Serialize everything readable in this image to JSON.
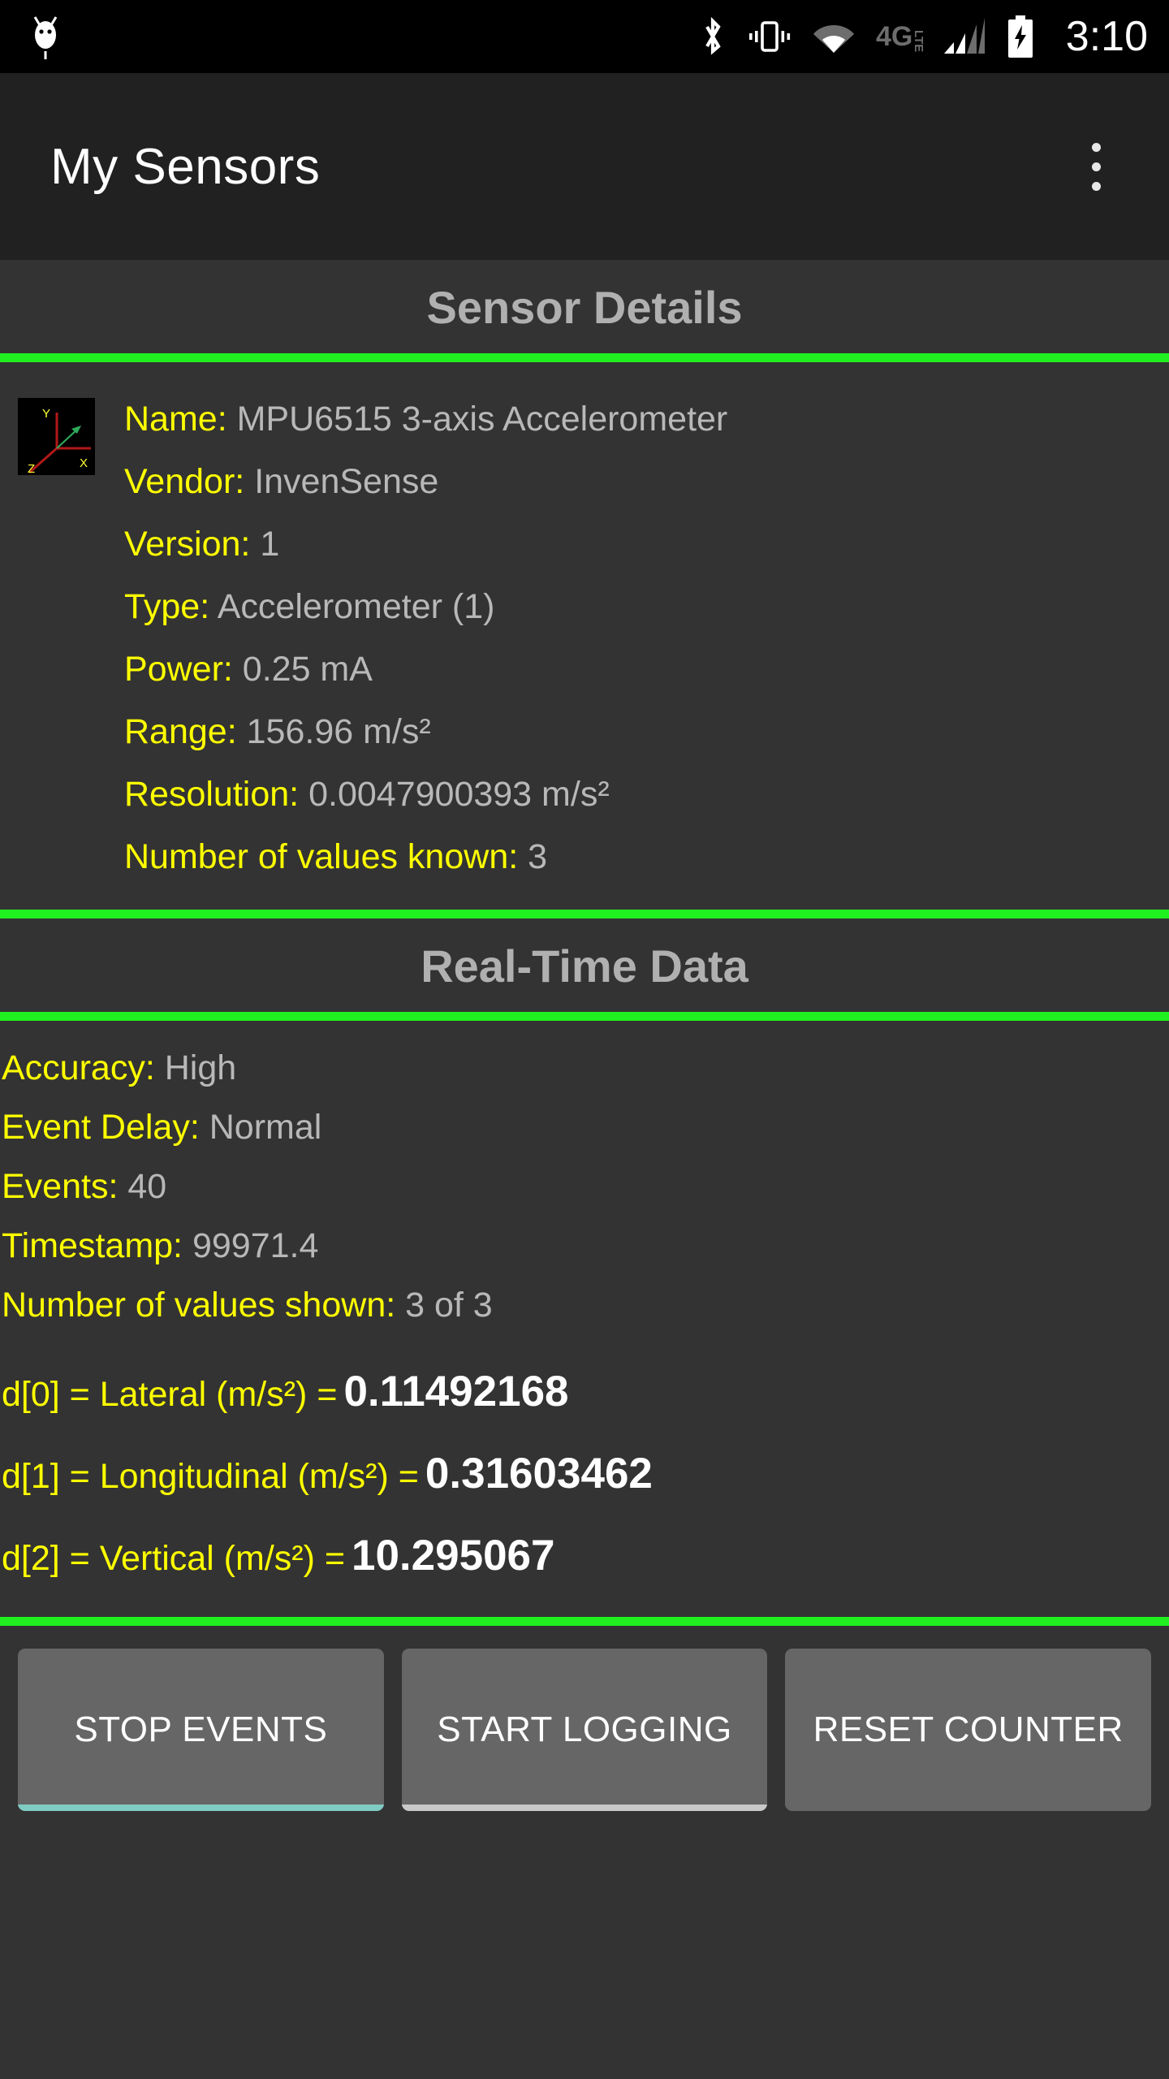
{
  "statusbar": {
    "clock": "3:10",
    "icons": [
      "android-robot-icon",
      "bluetooth-icon",
      "vibrate-icon",
      "wifi-icon",
      "4g-lte-icon",
      "cell-signal-icon",
      "battery-charging-icon"
    ]
  },
  "appbar": {
    "title": "My Sensors",
    "overflow_label": "overflow-menu"
  },
  "sections": {
    "details_header": "Sensor Details",
    "realtime_header": "Real-Time Data"
  },
  "details": [
    {
      "label": "Name:",
      "value": "MPU6515 3-axis Accelerometer"
    },
    {
      "label": "Vendor:",
      "value": "InvenSense"
    },
    {
      "label": "Version:",
      "value": "1"
    },
    {
      "label": "Type:",
      "value": "Accelerometer (1)"
    },
    {
      "label": "Power:",
      "value": "0.25  mA"
    },
    {
      "label": "Range:",
      "value": "156.96  m/s²"
    },
    {
      "label": "Resolution:",
      "value": "0.0047900393  m/s²"
    },
    {
      "label": "Number of values known:",
      "value": "3"
    }
  ],
  "realtime": [
    {
      "label": "Accuracy:",
      "value": "High"
    },
    {
      "label": "Event Delay:",
      "value": "Normal"
    },
    {
      "label": "Events:",
      "value": "40"
    },
    {
      "label": "Timestamp:",
      "value": "99971.4"
    },
    {
      "label": "Number of values shown:",
      "value": " 3 of 3"
    }
  ],
  "axes": [
    {
      "label": "d[0] = Lateral (m/s²) =",
      "value": "0.11492168"
    },
    {
      "label": "d[1] = Longitudinal (m/s²) =",
      "value": "0.31603462"
    },
    {
      "label": "d[2] = Vertical (m/s²) =",
      "value": "10.295067"
    }
  ],
  "buttons": [
    {
      "label": "STOP EVENTS",
      "underline": "teal"
    },
    {
      "label": "START LOGGING",
      "underline": "gray"
    },
    {
      "label": "RESET COUNTER",
      "underline": "none"
    }
  ],
  "colors": {
    "accent_green": "#20f020",
    "label_yellow": "#ffff00",
    "value_gray": "#b8b8b8",
    "background": "#333333",
    "appbar": "#212121",
    "button": "#666666",
    "teal_underline": "#80cbc4"
  },
  "sensor_icon": {
    "axis_labels": [
      "Y",
      "X",
      "Z"
    ]
  }
}
